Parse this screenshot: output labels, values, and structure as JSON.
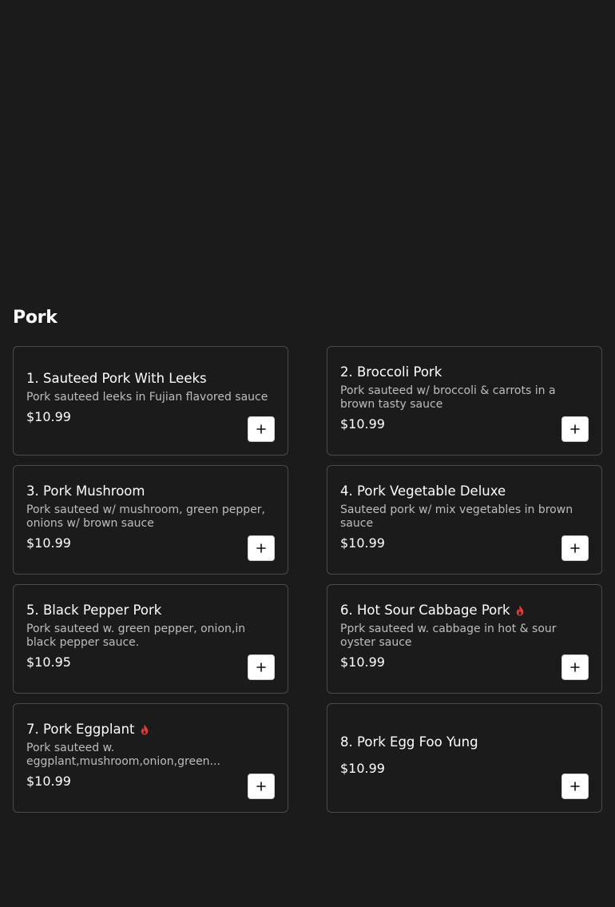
{
  "section": {
    "title": "Pork"
  },
  "colors": {
    "background": "#1b1b1b",
    "card_border": "#4a4a4a",
    "spicy": "#e23b3b",
    "add_button": "#ffffff"
  },
  "items": [
    {
      "name": "1. Sauteed Pork With Leeks",
      "description": "Pork sauteed leeks in Fujian flavored sauce",
      "price": "$10.99",
      "spicy": false,
      "add_icon": "plus-icon"
    },
    {
      "name": "2. Broccoli Pork",
      "description": "Pork sauteed w/ broccoli & carrots in a brown tasty sauce",
      "price": "$10.99",
      "spicy": false,
      "add_icon": "plus-icon"
    },
    {
      "name": "3. Pork Mushroom",
      "description": "Pork sauteed w/ mushroom, green pepper, onions w/ brown sauce",
      "price": "$10.99",
      "spicy": false,
      "add_icon": "plus-icon"
    },
    {
      "name": "4. Pork Vegetable Deluxe",
      "description": "Sauteed pork w/ mix vegetables in brown sauce",
      "price": "$10.99",
      "spicy": false,
      "add_icon": "plus-icon"
    },
    {
      "name": "5. Black Pepper Pork",
      "description": "Pork sauteed w. green pepper, onion,in black pepper sauce.",
      "price": "$10.95",
      "spicy": false,
      "add_icon": "plus-icon"
    },
    {
      "name": "6. Hot Sour Cabbage Pork",
      "description": "Pprk sauteed w. cabbage in hot & sour oyster sauce",
      "price": "$10.99",
      "spicy": true,
      "spicy_icon": "flame-icon",
      "add_icon": "plus-icon"
    },
    {
      "name": "7. Pork Eggplant",
      "description": "Pork sauteed w. eggplant,mushroom,onion,green...",
      "price": "$10.99",
      "spicy": true,
      "spicy_icon": "flame-icon",
      "add_icon": "plus-icon"
    },
    {
      "name": "8. Pork Egg Foo Yung",
      "description": "",
      "price": "$10.99",
      "spicy": false,
      "add_icon": "plus-icon"
    }
  ]
}
